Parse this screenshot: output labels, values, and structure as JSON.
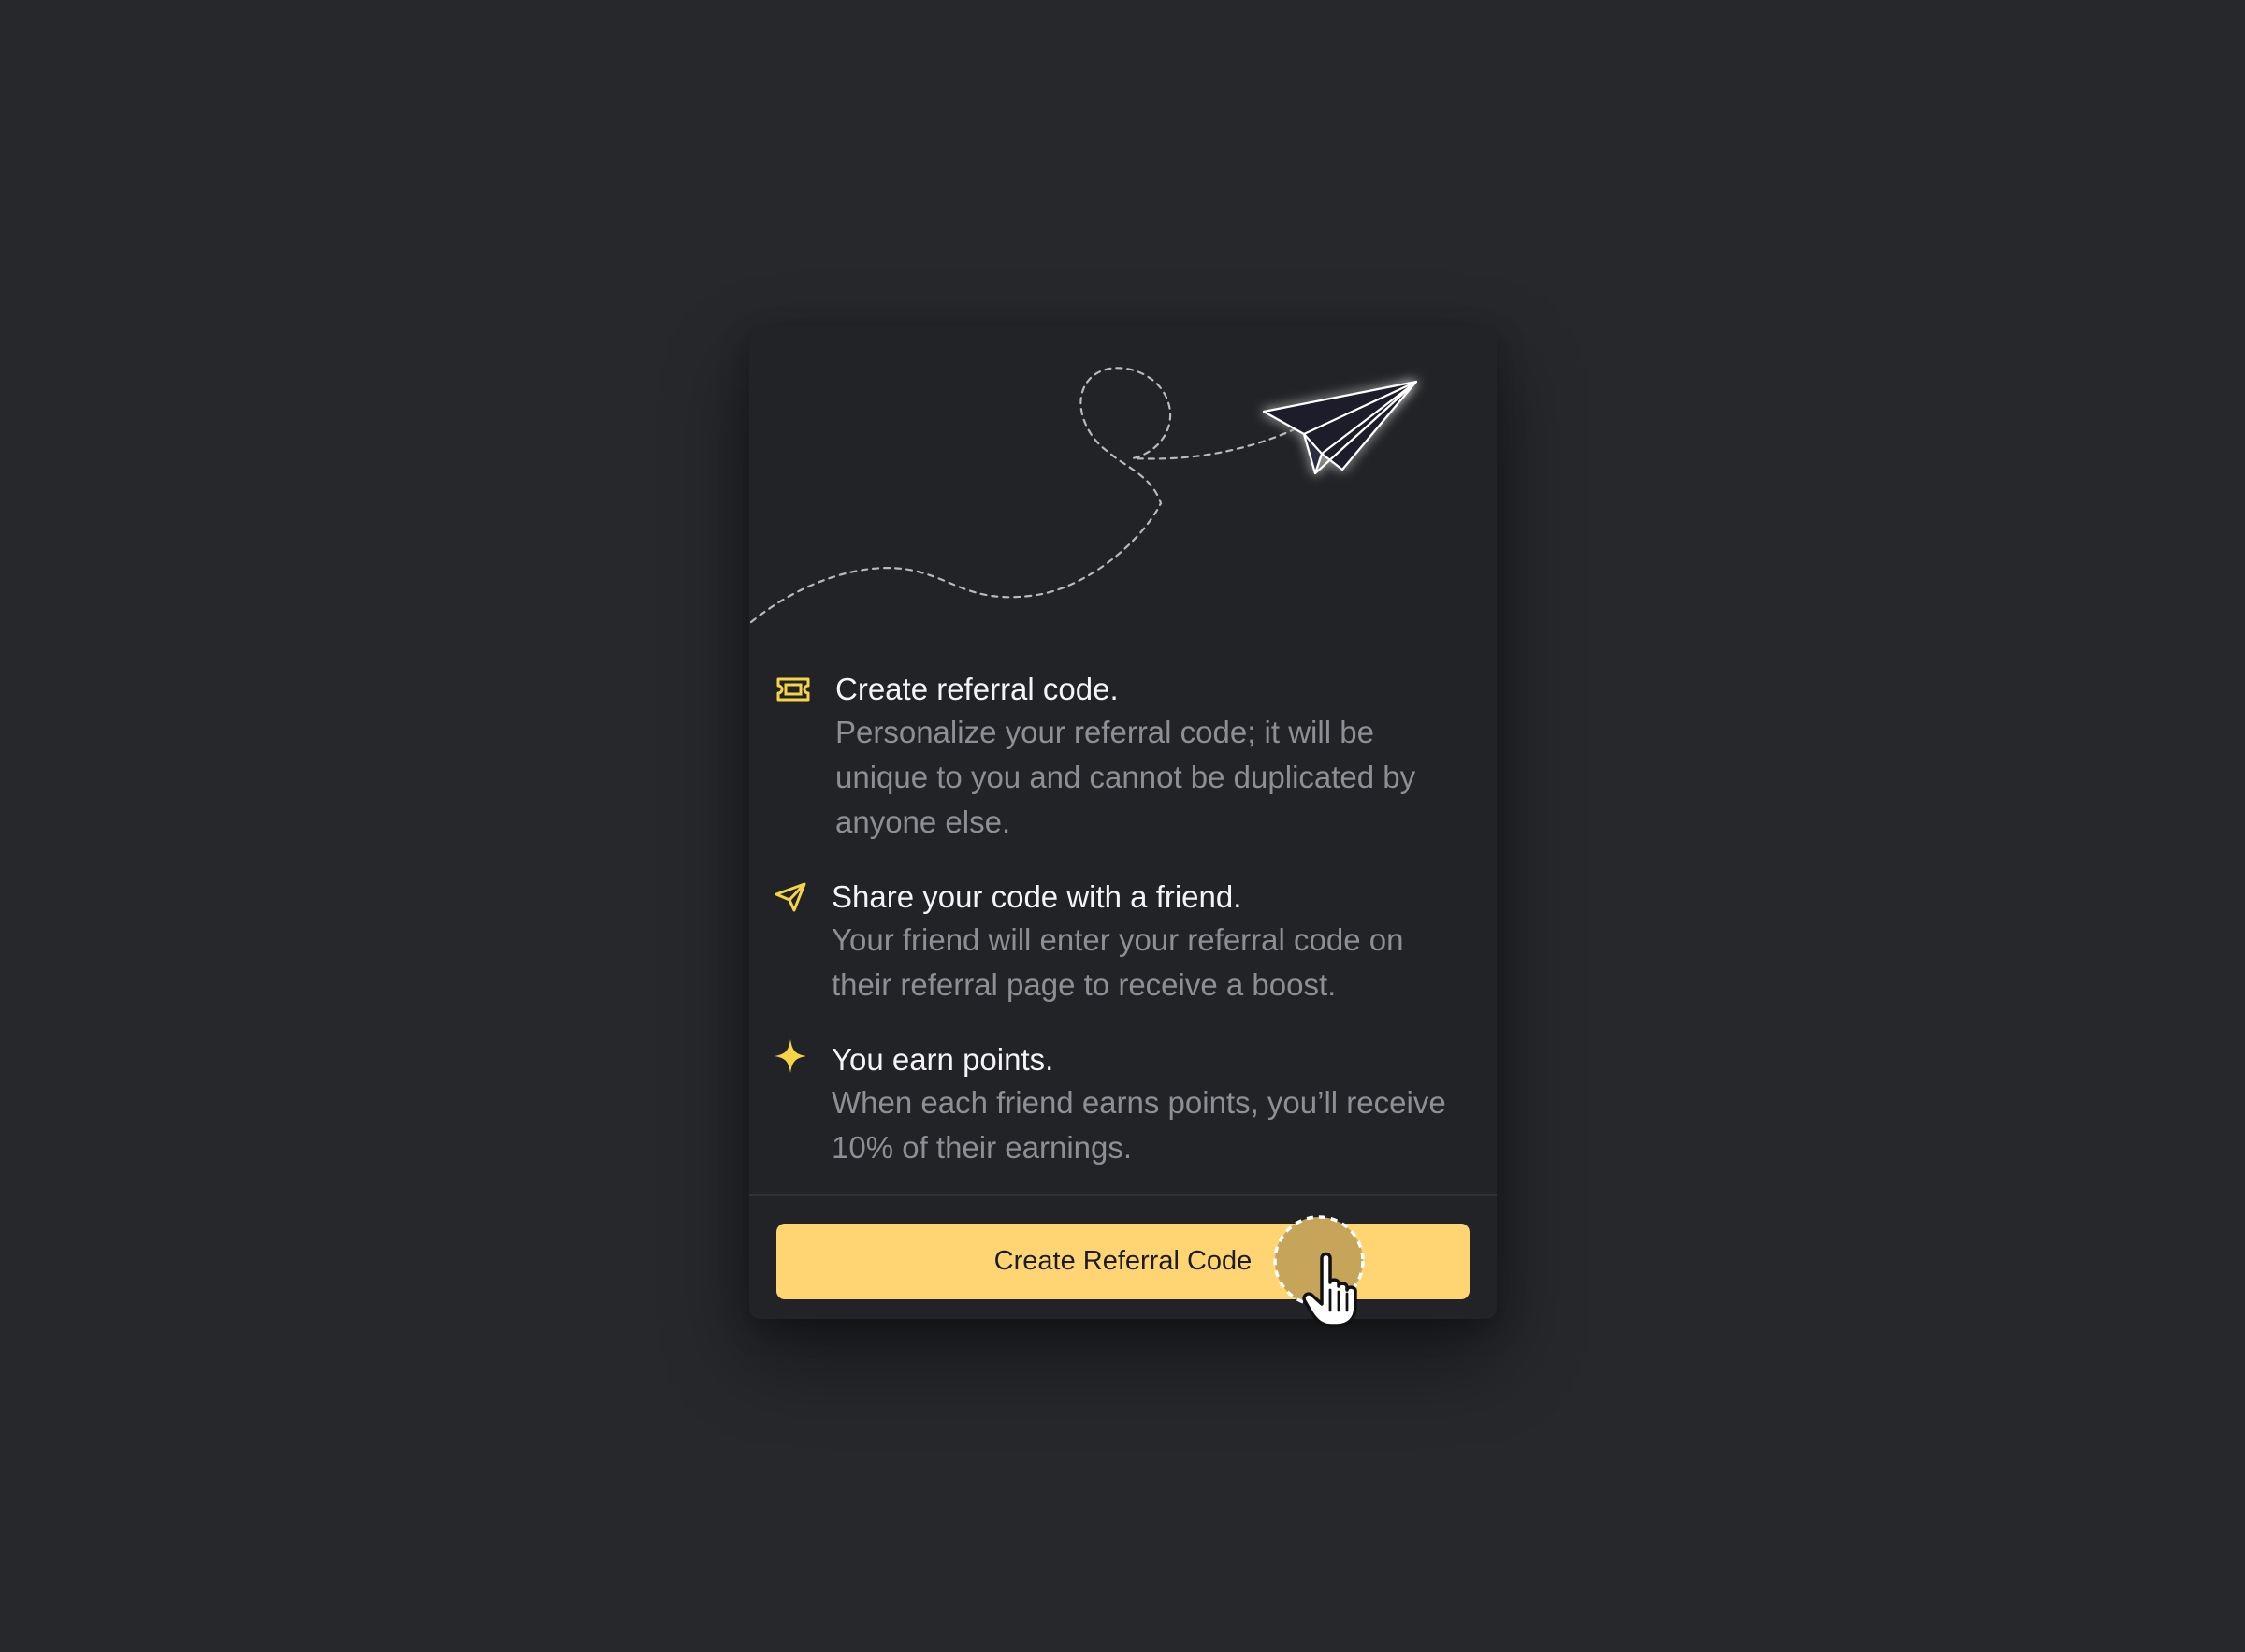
{
  "card": {
    "steps": [
      {
        "icon": "ticket-icon",
        "title": "Create referral code.",
        "description": "Personalize your referral code; it will be unique to you and cannot be duplicated by anyone else."
      },
      {
        "icon": "paper-plane-icon",
        "title": "Share your code with a friend.",
        "description": "Your friend will enter your referral code on their referral page to receive a boost."
      },
      {
        "icon": "sparkle-icon",
        "title": "You earn points.",
        "description": "When each friend earns points, you’ll receive 10% of their earnings."
      }
    ],
    "cta_label": "Create Referral Code"
  },
  "colors": {
    "background": "#26282c",
    "card": "#222326",
    "accent": "#ffd472",
    "icon_accent": "#f5d447",
    "title_text": "#f4f4f6",
    "body_text": "#8d8f95"
  },
  "illustration": "paper-plane-flight-illustration"
}
